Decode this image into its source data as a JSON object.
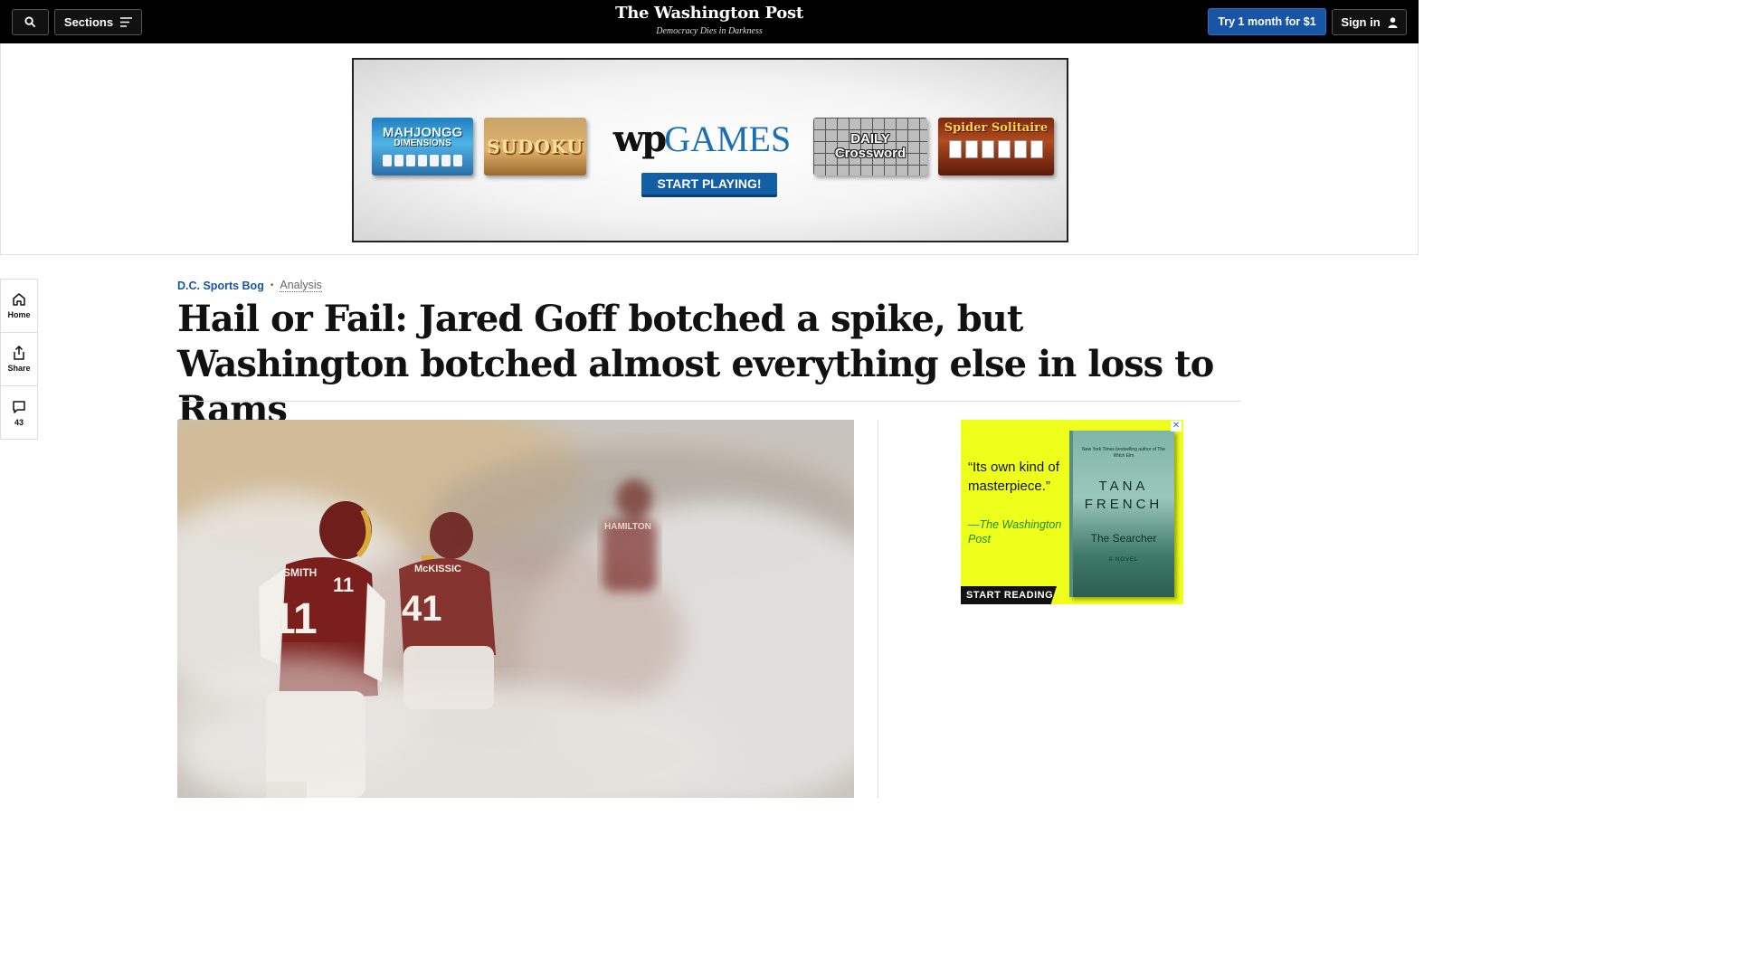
{
  "header": {
    "search_icon": "search-icon",
    "sections_label": "Sections",
    "logo_text": "The Washington Post",
    "tagline": "Democracy Dies in Darkness",
    "try_label": "Try 1 month for $1",
    "signin_label": "Sign in"
  },
  "top_ad": {
    "games": {
      "mahjong_line1": "MAHJONGG",
      "mahjong_line2": "DIMENSIONS",
      "sudoku": "SUDOKU",
      "brand_wp": "wp",
      "brand_games": "GAMES",
      "start_playing": "START PLAYING!",
      "crossword_line1": "DAILY",
      "crossword_line2": "Crossword",
      "spider": "Spider Solitaire"
    }
  },
  "rail": {
    "home_label": "Home",
    "share_label": "Share",
    "comments_count": "43"
  },
  "article": {
    "section": "D.C. Sports Bog",
    "label": "Analysis",
    "headline": "Hail or Fail: Jared Goff botched a spike, but Washington botched almost everything else in loss to Rams",
    "photo_jerseys": {
      "front_name": "SMITH",
      "front_number": "11",
      "middle_name": "McKISSIC",
      "middle_number": "41",
      "back_name": "HAMILTON"
    }
  },
  "side_ad": {
    "quote": "“Its own kind of masterpiece.”",
    "attribution": "—The Washington Post",
    "cta": "START READING",
    "book_blurb": "New York Times bestselling author of The Witch Elm",
    "book_author": "TANA FRENCH",
    "book_title": "The Searcher",
    "book_subtitle": "A NOVEL",
    "close_symbol": "✕"
  }
}
